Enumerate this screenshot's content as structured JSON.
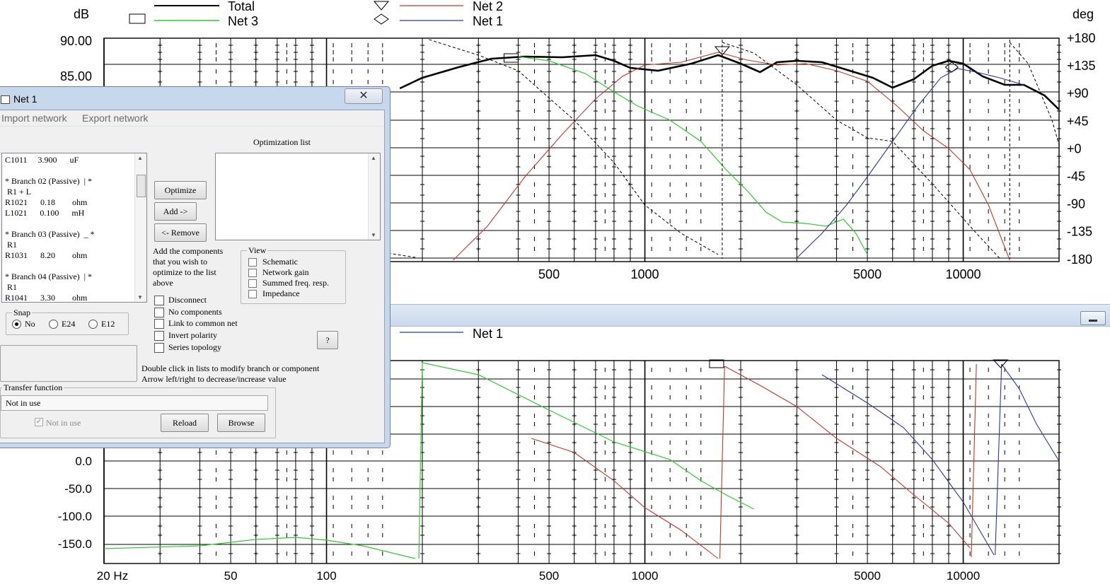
{
  "top_graph": {
    "left_unit": "dB",
    "right_unit": "deg",
    "y_ticks_left": [
      "90.00",
      "85.00"
    ],
    "y_ticks_right": [
      "+180",
      "+135",
      "+90",
      "+45",
      "+0",
      "-45",
      "-90",
      "-135",
      "-180"
    ],
    "x_ticks": [
      "500",
      "1000",
      "5000",
      "10000"
    ],
    "legend": [
      {
        "name": "Total",
        "color": "#000000",
        "marker": "rectangle"
      },
      {
        "name": "Net 3",
        "color": "#2ecc2e",
        "marker": "rectangle"
      },
      {
        "name": "Net 2",
        "color": "#c0392b",
        "marker": "triangle"
      },
      {
        "name": "Net 1",
        "color": "#2a3aa0",
        "marker": "diamond"
      }
    ]
  },
  "bottom_graph": {
    "legend": [
      {
        "name": "Net 1",
        "color": "#2a3aa0"
      }
    ],
    "y_ticks_left": [
      "0.0",
      "-50.0",
      "-100.0",
      "-150.0"
    ],
    "x_ticks": [
      "20 Hz",
      "50",
      "100",
      "500",
      "1000",
      "5000",
      "10000"
    ]
  },
  "colors": {
    "net1": "#2a3aa0",
    "net2": "#c0392b",
    "net3": "#2ecc2e",
    "total": "#000000"
  },
  "dialog": {
    "title": "Net 1",
    "close_icon": "close-icon",
    "menu": [
      "Import network",
      "Export network"
    ],
    "component_list": [
      "C1011     3.900      uF",
      "",
      "* Branch 02 (Passive)  | *",
      " R1 + L",
      "R1021      0.18        ohm",
      "L1021      0.100      mH",
      "",
      "* Branch 03 (Passive)  _ *",
      " R1",
      "R1031      8.20        ohm",
      "",
      "* Branch 04 (Passive)  | *",
      " R1",
      "R1041      3.30        ohm"
    ],
    "optimization_list_label": "Optimization list",
    "buttons": {
      "optimize": "Optimize",
      "add": "Add ->",
      "remove": "<- Remove",
      "help": "?",
      "reload": "Reload",
      "browse": "Browse"
    },
    "hint": [
      "Add the components",
      "that you wish to",
      "optimize to the list",
      "above"
    ],
    "view": {
      "title": "View",
      "items": [
        "Schematic",
        "Network gain",
        "Summed freq. resp.",
        "Impedance"
      ]
    },
    "options": [
      "Disconnect",
      "No components",
      "Link to common net",
      "Invert polarity",
      "Series topology"
    ],
    "snap": {
      "title": "Snap",
      "options": [
        "No",
        "E24",
        "E12"
      ],
      "selected": "No"
    },
    "instructions": [
      "Double click in lists to modify branch or component",
      "Arrow left/right to decrease/increase value"
    ],
    "transfer": {
      "title": "Transfer function",
      "value": "Not in use",
      "checkbox_label": "Not in use",
      "checkbox_checked": true
    }
  }
}
